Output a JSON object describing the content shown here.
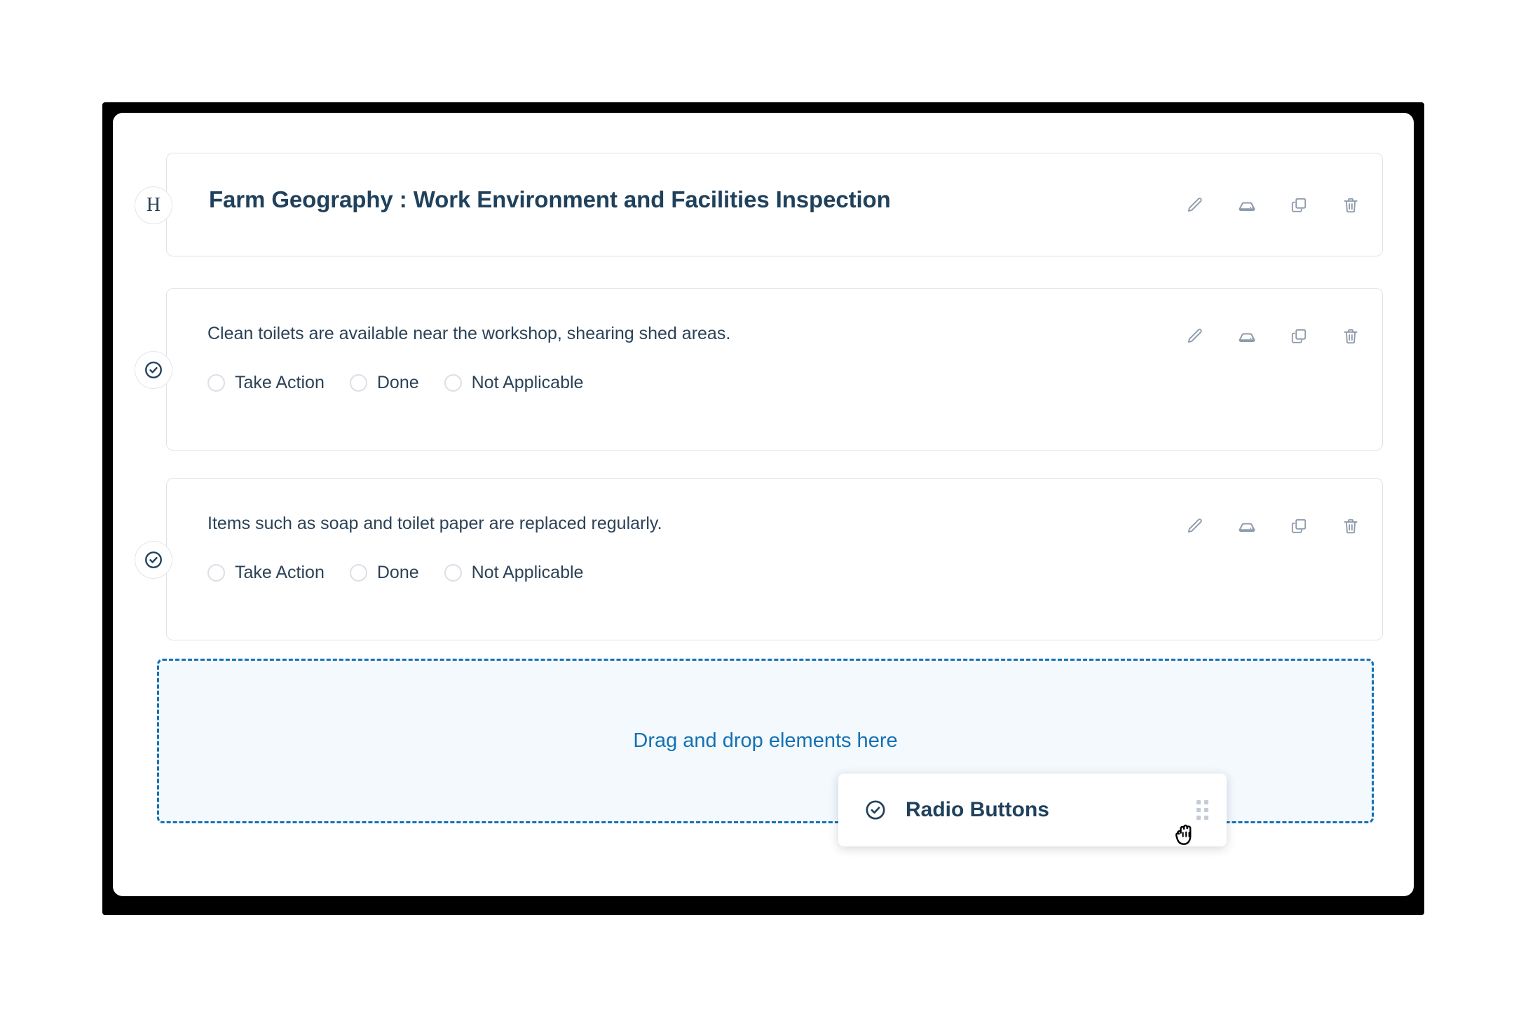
{
  "builder": {
    "header": {
      "badge_letter": "H",
      "title": "Farm Geography : Work Environment and Facilities Inspection",
      "actions": [
        {
          "name": "edit-icon",
          "label": "Edit"
        },
        {
          "name": "device-icon",
          "label": "Device"
        },
        {
          "name": "duplicate-icon",
          "label": "Duplicate"
        },
        {
          "name": "delete-icon",
          "label": "Delete"
        }
      ]
    },
    "questions": [
      {
        "badge_icon": "check-circle-icon",
        "text": "Clean toilets are available near the workshop, shearing shed areas.",
        "options": [
          {
            "label": "Take Action",
            "selected": false
          },
          {
            "label": "Done",
            "selected": false
          },
          {
            "label": "Not Applicable",
            "selected": false
          }
        ],
        "actions": [
          {
            "name": "edit-icon",
            "label": "Edit"
          },
          {
            "name": "device-icon",
            "label": "Device"
          },
          {
            "name": "duplicate-icon",
            "label": "Duplicate"
          },
          {
            "name": "delete-icon",
            "label": "Delete"
          }
        ]
      },
      {
        "badge_icon": "check-circle-icon",
        "text": "Items such as soap and toilet paper are replaced regularly.",
        "options": [
          {
            "label": "Take Action",
            "selected": false
          },
          {
            "label": "Done",
            "selected": false
          },
          {
            "label": "Not Applicable",
            "selected": false
          }
        ],
        "actions": [
          {
            "name": "edit-icon",
            "label": "Edit"
          },
          {
            "name": "device-icon",
            "label": "Device"
          },
          {
            "name": "duplicate-icon",
            "label": "Duplicate"
          },
          {
            "name": "delete-icon",
            "label": "Delete"
          }
        ]
      }
    ],
    "drop_zone": {
      "label": "Drag and drop elements here"
    },
    "dragging_element": {
      "icon": "check-circle-icon",
      "label": "Radio Buttons",
      "handle_icon": "drag-handle-icon",
      "cursor": "grabbing-hand-cursor"
    }
  },
  "colors": {
    "frame": "#000000",
    "panel": "#ffffff",
    "card_border": "#dfe3e8",
    "title_text": "#20415c",
    "body_text": "#2b4257",
    "icon_gray": "#8e9bab",
    "accent_blue": "#1471b3",
    "drop_fill": "#f3f9fd",
    "radio_border": "#dbe0e6"
  }
}
